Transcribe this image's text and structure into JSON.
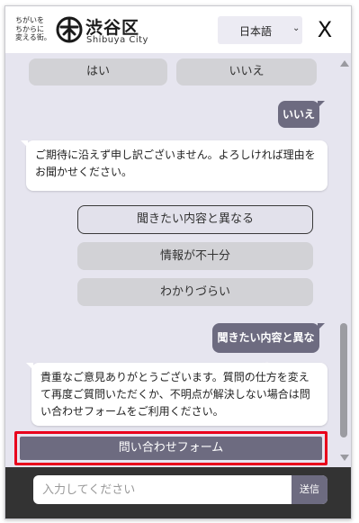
{
  "header": {
    "tagline": "ちがいを\nちからに\n変える街。",
    "logo_name": "渋谷区",
    "logo_sub": "Shibuya City",
    "language": "日本語",
    "language_chevron": "⌄",
    "close_label": "X"
  },
  "chat": {
    "top_buttons": [
      "はい",
      "いいえ"
    ],
    "user_reply_1": "いいえ",
    "bot_message_1": "ご期待に沿えず申し訳ございません。よろしければ理由をお聞かせください。",
    "reason_options": [
      "聞きたい内容と異なる",
      "情報が不十分",
      "わかりづらい"
    ],
    "user_reply_2": "聞きたい内容と異なる",
    "bot_message_2": "貴重なご意見ありがとうございます。質問の仕方を変えて再度ご質問いただくか、不明点が解決しない場合は問い合わせフォームをご利用ください。",
    "contact_button": "問い合わせフォーム"
  },
  "footer": {
    "input_placeholder": "入力してください",
    "input_value": "",
    "send_label": "送信"
  },
  "colors": {
    "accent": "#6d6b80",
    "chat_bg": "#e6e5ef",
    "highlight": "#e8001c",
    "footer_bg": "#333333"
  }
}
